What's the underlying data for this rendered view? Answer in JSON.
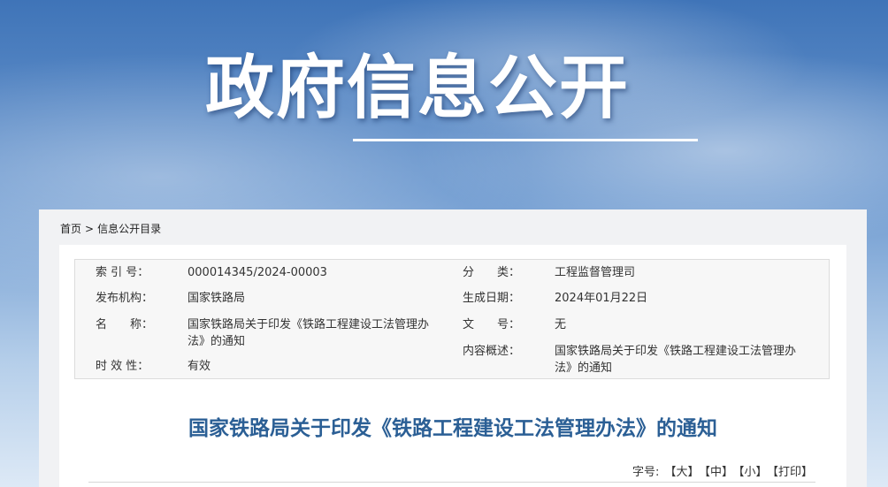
{
  "banner": {
    "title": "政府信息公开"
  },
  "breadcrumb": {
    "home": "首页",
    "separator": ">",
    "current": "信息公开目录"
  },
  "metadata": {
    "index_no_label": "索 引 号：",
    "index_no_value": "000014345/2024-00003",
    "category_label": "分　　类：",
    "category_value": "工程监督管理司",
    "publisher_label": "发布机构：",
    "publisher_value": "国家铁路局",
    "date_label": "生成日期：",
    "date_value": "2024年01月22日",
    "name_label": "名　　称：",
    "name_value": "国家铁路局关于印发《铁路工程建设工法管理办法》的通知",
    "doc_no_label": "文　　号：",
    "doc_no_value": "无",
    "summary_label": "内容概述：",
    "summary_value": "国家铁路局关于印发《铁路工程建设工法管理办法》的通知",
    "validity_label": "时 效 性：",
    "validity_value": "有效"
  },
  "document": {
    "title": "国家铁路局关于印发《铁路工程建设工法管理办法》的通知"
  },
  "font_controls": {
    "label": "字号:",
    "large": "【大】",
    "medium": "【中】",
    "small": "【小】",
    "print": "【打印】"
  },
  "colors": {
    "title_blue": "#2b5f95",
    "panel_bg": "#f1f2f4",
    "meta_bg": "#f7f7f7"
  }
}
